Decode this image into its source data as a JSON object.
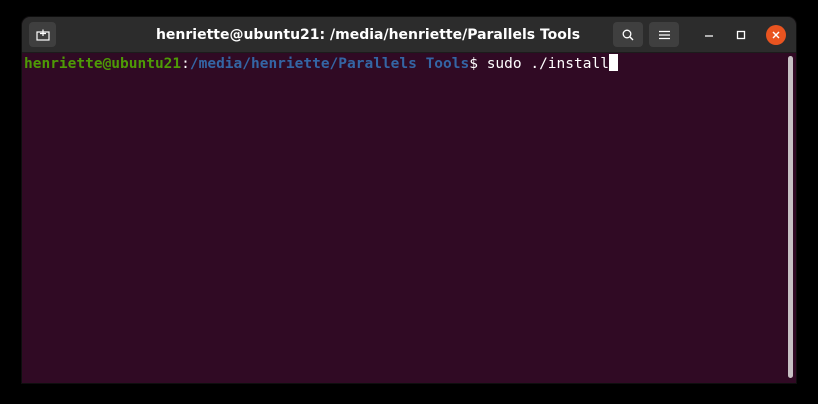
{
  "window": {
    "title": "henriette@ubuntu21: /media/henriette/Parallels Tools"
  },
  "titlebar": {
    "new_tab_icon": "new-tab-icon",
    "search_icon": "search-icon",
    "menu_icon": "hamburger-menu-icon",
    "minimize_icon": "minimize-icon",
    "maximize_icon": "maximize-icon",
    "close_icon": "close-icon"
  },
  "terminal": {
    "prompt_user": "henriette@ubuntu21",
    "prompt_sep": ":",
    "prompt_path": "/media/henriette/Parallels Tools",
    "prompt_symbol": "$ ",
    "command": "sudo ./install"
  },
  "colors": {
    "background": "#300a24",
    "titlebar": "#2c2c2c",
    "user": "#4e9a06",
    "path": "#3465a4",
    "close_button": "#e95420"
  }
}
